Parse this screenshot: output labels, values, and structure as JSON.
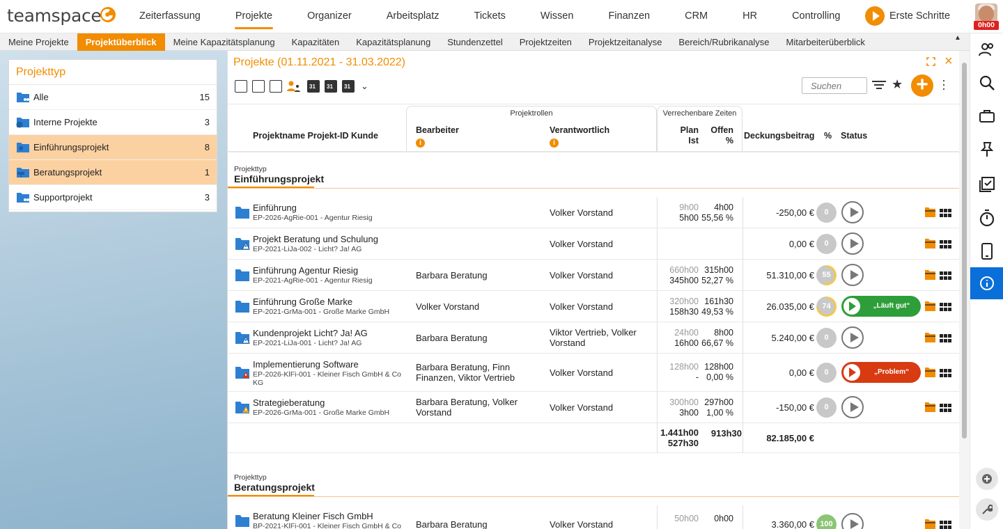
{
  "app": {
    "logo": "teamspace"
  },
  "nav": {
    "items": [
      "Zeiterfassung",
      "Projekte",
      "Organizer",
      "Arbeitsplatz",
      "Tickets",
      "Wissen",
      "Finanzen",
      "CRM",
      "HR",
      "Controlling"
    ],
    "erste_schritte": "Erste Schritte",
    "timer": "0h00"
  },
  "subnav": {
    "items": [
      "Meine Projekte",
      "Projektüberblick",
      "Meine Kapazitätsplanung",
      "Kapazitäten",
      "Kapazitätsplanung",
      "Stundenzettel",
      "Projektzeiten",
      "Projektzeitanalyse",
      "Bereich/Rubrikanalyse",
      "Mitarbeiterüberblick"
    ],
    "active": "Projektüberblick"
  },
  "projekttyp": {
    "title": "Projekttyp",
    "items": [
      {
        "label": "Alle",
        "count": "15"
      },
      {
        "label": "Interne Projekte",
        "count": "3"
      },
      {
        "label": "Einführungsprojekt",
        "count": "8"
      },
      {
        "label": "Beratungsprojekt",
        "count": "1"
      },
      {
        "label": "Supportprojekt",
        "count": "3"
      }
    ]
  },
  "main": {
    "title": "Projekte (01.11.2021 - 31.03.2022)",
    "search_placeholder": "Suchen"
  },
  "table": {
    "h_name": "Projektname Projekt-ID Kunde",
    "h_rollen": "Projektrollen",
    "h_bearbeiter": "Bearbeiter",
    "h_verantwortlich": "Verantwortlich",
    "h_zeiten": "Verrechenbare Zeiten",
    "h_plan": "Plan",
    "h_ist": "Ist",
    "h_offen": "Offen",
    "h_offen_pct": "%",
    "h_db": "Deckungsbeitrag",
    "h_pct": "%",
    "h_status": "Status",
    "info": "i"
  },
  "section1": {
    "small": "Projekttyp",
    "big": "Einführungsprojekt"
  },
  "rows": [
    {
      "name": "Einführung",
      "pid": "EP-2026-AgRie-001 - Agentur Riesig",
      "bearbeiter": "",
      "verantwortlich": "Volker Vorstand",
      "plan": "9h00",
      "ist": "5h00",
      "offen": "4h00",
      "offen_pct": "55,56 %",
      "db": "-250,00 €",
      "pct": "0"
    },
    {
      "name": "Projekt Beratung und Schulung",
      "pid": "EP-2021-LiJa-002 - Licht? Ja! AG",
      "bearbeiter": "",
      "verantwortlich": "Volker Vorstand",
      "plan": "",
      "ist": "",
      "offen": "",
      "offen_pct": "",
      "db": "0,00 €",
      "pct": "0"
    },
    {
      "name": "Einführung Agentur Riesig",
      "pid": "EP-2021-AgRie-001 - Agentur Riesig",
      "bearbeiter": "Barbara Beratung",
      "verantwortlich": "Volker Vorstand",
      "plan": "660h00",
      "ist": "345h00",
      "offen": "315h00",
      "offen_pct": "52,27 %",
      "db": "51.310,00 €",
      "pct": "55"
    },
    {
      "name": "Einführung Große Marke",
      "pid": "EP-2021-GrMa-001 - Große Marke GmbH",
      "bearbeiter": "Volker Vorstand",
      "verantwortlich": "Volker Vorstand",
      "plan": "320h00",
      "ist": "158h30",
      "offen": "161h30",
      "offen_pct": "49,53 %",
      "db": "26.035,00 €",
      "pct": "74",
      "status": "„Läuft gut“"
    },
    {
      "name": "Kundenprojekt Licht? Ja! AG",
      "pid": "EP-2021-LiJa-001 - Licht? Ja! AG",
      "bearbeiter": "Barbara Beratung",
      "verantwortlich": "Viktor Vertrieb, Volker Vorstand",
      "plan": "24h00",
      "ist": "16h00",
      "offen": "8h00",
      "offen_pct": "66,67 %",
      "db": "5.240,00 €",
      "pct": "0"
    },
    {
      "name": "Implementierung Software",
      "pid": "EP-2026-KlFi-001 - Kleiner Fisch GmbH & Co KG",
      "bearbeiter": "Barbara Beratung, Finn Finanzen, Viktor Vertrieb",
      "verantwortlich": "Volker Vorstand",
      "plan": "128h00",
      "ist": "-",
      "offen": "128h00",
      "offen_pct": "0,00 %",
      "db": "0,00 €",
      "pct": "0",
      "status": "„Problem“"
    },
    {
      "name": "Strategieberatung",
      "pid": "EP-2026-GrMa-001 - Große Marke GmbH",
      "bearbeiter": "Barbara Beratung, Volker Vorstand",
      "verantwortlich": "Volker Vorstand",
      "plan": "300h00",
      "ist": "3h00",
      "offen": "297h00",
      "offen_pct": "1,00 %",
      "db": "-150,00 €",
      "pct": "0"
    }
  ],
  "totals": {
    "plan": "1.441h00",
    "ist": "527h30",
    "offen": "913h30",
    "db": "82.185,00 €"
  },
  "section2": {
    "small": "Projekttyp",
    "big": "Beratungsprojekt"
  },
  "row2": {
    "name": "Beratung Kleiner Fisch GmbH",
    "pid": "BP-2021-KlFi-001 - Kleiner Fisch GmbH & Co",
    "bearbeiter": "Barbara Beratung",
    "verantwortlich": "Volker Vorstand",
    "plan": "50h00",
    "offen": "0h00",
    "db": "3.360,00 €",
    "pct": "100"
  },
  "colors": {
    "accent": "#f28c00",
    "selected": "#fcd1a1",
    "green": "#2e9e3a",
    "red": "#d83a12",
    "blue": "#0a6fd8",
    "folder": "#2d7fd1"
  }
}
